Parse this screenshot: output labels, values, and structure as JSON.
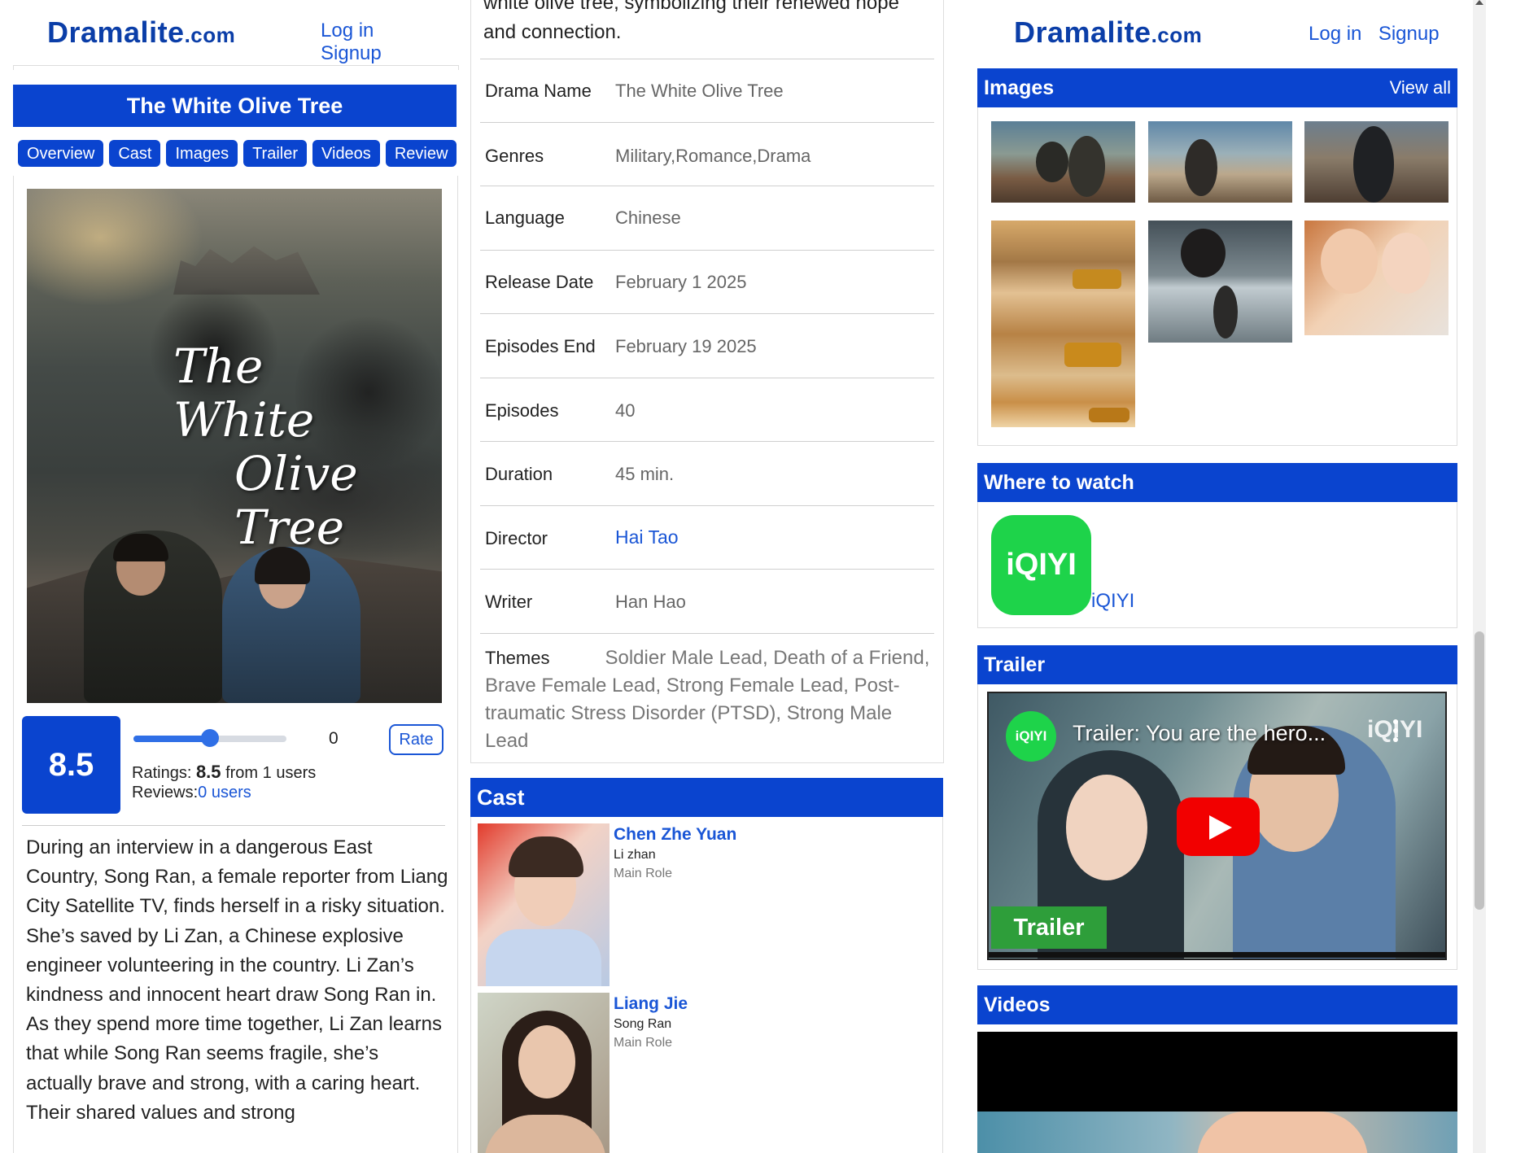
{
  "site": {
    "brand_main": "Dramalite",
    "brand_suffix": ".com",
    "login": "Log in",
    "signup": "Signup"
  },
  "drama": {
    "title": "The White Olive Tree",
    "poster_title_line1": "The White",
    "poster_title_line2": "Olive Tree",
    "tabs": [
      "Overview",
      "Cast",
      "Images",
      "Trailer",
      "Videos",
      "Review"
    ]
  },
  "rating": {
    "score": "8.5",
    "slider_value": "0",
    "slider_fraction": 0.5,
    "rate_label": "Rate",
    "ratings_prefix": "Ratings: ",
    "ratings_score": "8.5",
    "ratings_suffix": " from 1 users",
    "reviews_prefix": "Reviews:",
    "reviews_link": "0 users"
  },
  "synopsis": "During an interview in a dangerous East Country, Song Ran, a female reporter from Liang City Satellite TV, finds herself in a risky situation. She’s saved by Li Zan, a Chinese explosive engineer volunteering in the country. Li Zan’s kindness and innocent heart draw Song Ran in. As they spend more time together, Li Zan learns that while Song Ran seems fragile, she’s actually brave and strong, with a caring heart. Their shared values and strong",
  "details": {
    "intro_cut": "white olive tree, symbolizing their renewed hope",
    "intro_end": "and connection.",
    "rows": [
      {
        "label": "Drama Name",
        "value": "The White Olive Tree"
      },
      {
        "label": "Genres",
        "value": "Military,Romance,Drama"
      },
      {
        "label": "Language",
        "value": "Chinese"
      },
      {
        "label": "Release Date",
        "value": "February 1 2025"
      },
      {
        "label": "Episodes End",
        "value": "February 19 2025"
      },
      {
        "label": "Episodes",
        "value": "40"
      },
      {
        "label": "Duration",
        "value": "45 min."
      },
      {
        "label": "Director",
        "value": "Hai Tao"
      },
      {
        "label": "Writer",
        "value": "Han Hao"
      }
    ],
    "themes_label": "Themes",
    "themes_value": "Soldier Male Lead, Death of a Friend, Brave Female Lead, Strong Female Lead, Post-traumatic Stress Disorder (PTSD), Strong Male Lead"
  },
  "cast": {
    "heading": "Cast",
    "members": [
      {
        "name": "Chen Zhe Yuan",
        "character": "Li zhan",
        "role": "Main Role"
      },
      {
        "name": "Liang Jie",
        "character": "Song Ran",
        "role": "Main Role"
      }
    ]
  },
  "images_section": {
    "heading": "Images",
    "view_all": "View all"
  },
  "where_to_watch": {
    "heading": "Where to watch",
    "logo_text": "iQIYI",
    "platform": "iQIYI"
  },
  "trailer": {
    "heading": "Trailer",
    "channel_avatar": "iQIYI",
    "video_title": "Trailer: You are the hero...",
    "watermark": "iQIYI",
    "badge": "Trailer"
  },
  "videos": {
    "heading": "Videos"
  },
  "colors": {
    "brand_blue": "#0a44cf",
    "link_blue": "#1a56d6",
    "iqiyi_green": "#1ed34a",
    "youtube_red": "#f20000"
  }
}
